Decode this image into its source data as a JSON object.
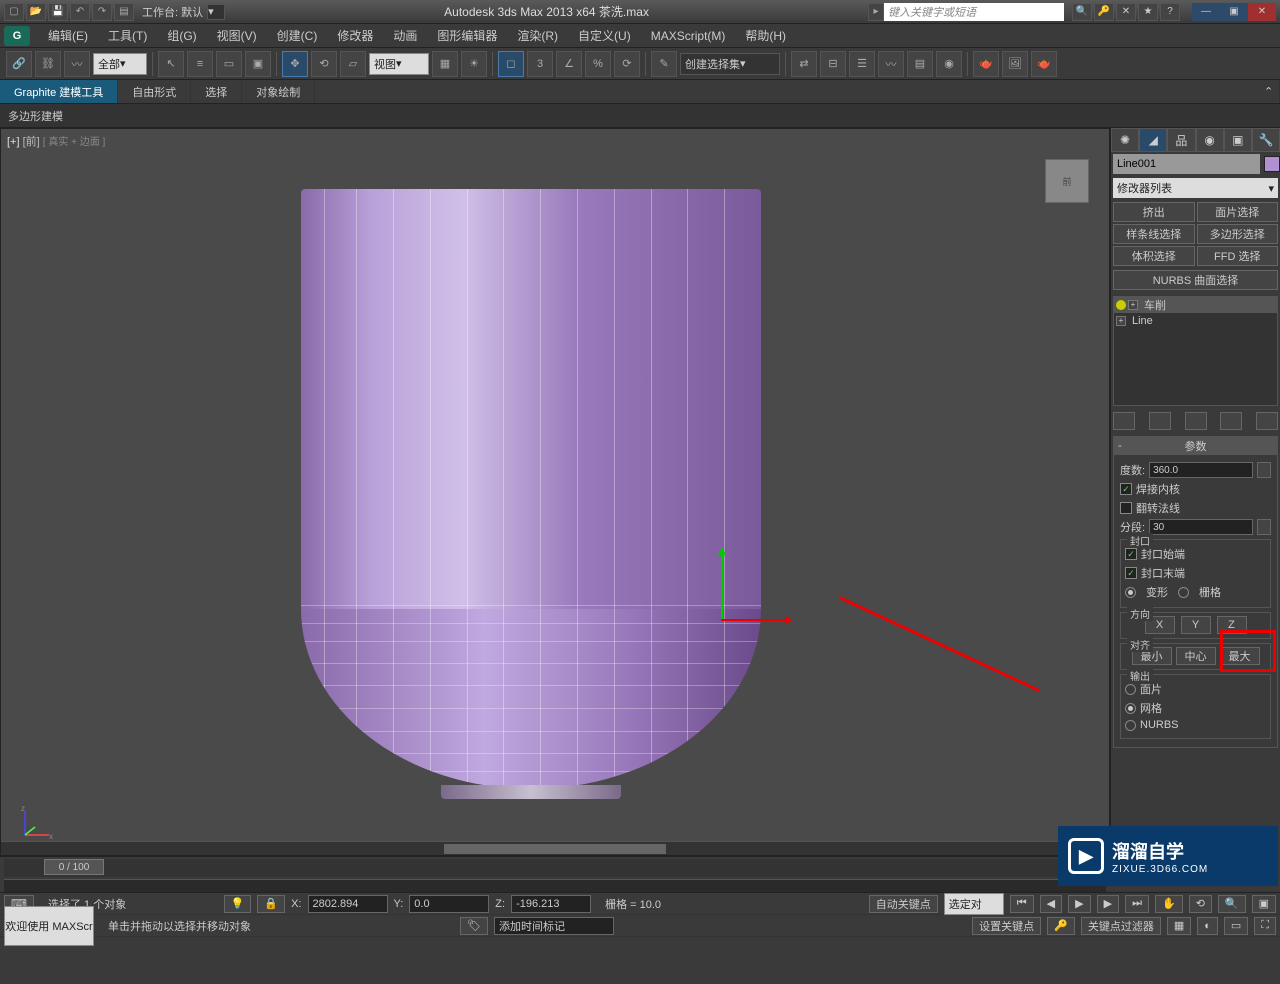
{
  "titlebar": {
    "workspace_label": "工作台: 默认",
    "app_title": "Autodesk 3ds Max  2013 x64   茶洗.max",
    "search_placeholder": "键入关键字或短语"
  },
  "menubar": {
    "items": [
      "编辑(E)",
      "工具(T)",
      "组(G)",
      "视图(V)",
      "创建(C)",
      "修改器",
      "动画",
      "图形编辑器",
      "渲染(R)",
      "自定义(U)",
      "MAXScript(M)",
      "帮助(H)"
    ]
  },
  "maintoolbar": {
    "filter_dd": "全部",
    "view_dd": "视图",
    "selectionset_dd": "创建选择集"
  },
  "ribbon": {
    "tabs": [
      "Graphite 建模工具",
      "自由形式",
      "选择",
      "对象绘制"
    ],
    "subtab": "多边形建模"
  },
  "viewport": {
    "label_plus": "[+]",
    "label_view": "[前]",
    "label_shade": "[ 真实 + 边面 ]",
    "viewcube": "前"
  },
  "cmdpanel": {
    "obj_name": "Line001",
    "mod_dd": "修改器列表",
    "mod_buttons": [
      "挤出",
      "面片选择",
      "样条线选择",
      "多边形选择",
      "体积选择",
      "FFD 选择"
    ],
    "nurbs_label": "NURBS 曲面选择",
    "stack": [
      "车削",
      "Line"
    ],
    "rollout_title": "参数",
    "degrees_label": "度数:",
    "degrees_value": "360.0",
    "weld_label": "焊接内核",
    "flip_label": "翻转法线",
    "segments_label": "分段:",
    "segments_value": "30",
    "cap_group": "封口",
    "cap_start": "封口始端",
    "cap_end": "封口末端",
    "cap_morph": "变形",
    "cap_grid": "栅格",
    "dir_group": "方向",
    "axis": [
      "X",
      "Y",
      "Z"
    ],
    "align_group": "对齐",
    "align": [
      "最小",
      "中心",
      "最大"
    ],
    "output_group": "输出",
    "output": [
      "面片",
      "网格",
      "NURBS"
    ]
  },
  "timeline": {
    "frame": "0 / 100"
  },
  "status": {
    "selected_text": "选择了 1 个对象",
    "hint_text": "单击并拖动以选择并移动对象",
    "x_label": "X:",
    "x_val": "2802.894",
    "y_label": "Y:",
    "y_val": "0.0",
    "z_label": "Z:",
    "z_val": "-196.213",
    "grid_label": "栅格 = 10.0",
    "autokey": "自动关键点",
    "setkey": "设置关键点",
    "keyfilter": "关键点过滤器",
    "selected_dd": "选定对",
    "addtime": "添加时间标记",
    "welcome": "欢迎使用  MAXScr"
  },
  "watermark": {
    "brand": "溜溜自学",
    "url": "ZIXUE.3D66.COM"
  }
}
